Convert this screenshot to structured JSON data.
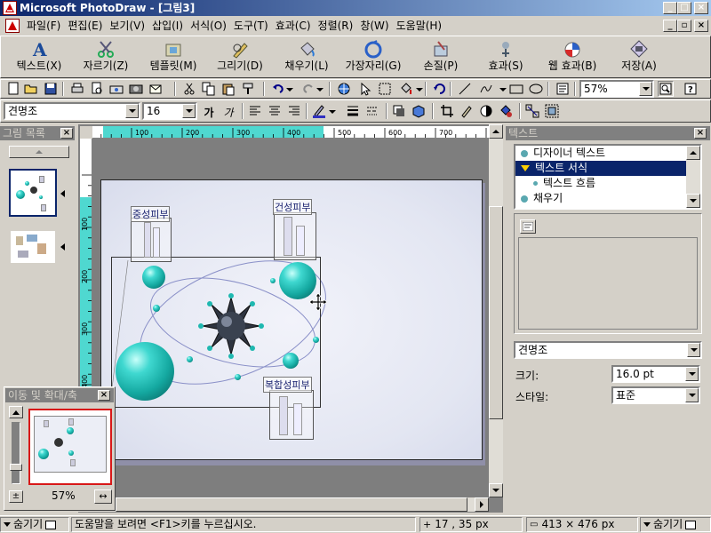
{
  "window": {
    "title": "Microsoft PhotoDraw - [그림3]",
    "controls": [
      "_",
      "□",
      "×"
    ]
  },
  "menu": {
    "items": [
      "파일(F)",
      "편집(E)",
      "보기(V)",
      "삽입(I)",
      "서식(O)",
      "도구(T)",
      "효과(C)",
      "정렬(R)",
      "창(W)",
      "도움말(H)"
    ],
    "doc_controls": [
      "_",
      "▫",
      "×"
    ]
  },
  "visual_menu": {
    "items": [
      {
        "label": "텍스트(X)",
        "icon": "text-a-icon"
      },
      {
        "label": "자르기(Z)",
        "icon": "scissors-icon"
      },
      {
        "label": "템플릿(M)",
        "icon": "template-folder-icon"
      },
      {
        "label": "그리기(D)",
        "icon": "draw-pen-icon"
      },
      {
        "label": "채우기(L)",
        "icon": "fill-bucket-icon"
      },
      {
        "label": "가장자리(G)",
        "icon": "edge-icon"
      },
      {
        "label": "손질(P)",
        "icon": "touchup-icon"
      },
      {
        "label": "효과(S)",
        "icon": "effects-icon"
      },
      {
        "label": "웹 효과(B)",
        "icon": "web-effects-icon"
      },
      {
        "label": "저장(A)",
        "icon": "save-diamond-icon"
      }
    ]
  },
  "standard_toolbar": {
    "zoom": "57%"
  },
  "format_toolbar": {
    "font": "견명조",
    "size": "16",
    "bold": "가",
    "italic": "가"
  },
  "ruler": {
    "h_labels": [
      "100",
      "200",
      "300",
      "400",
      "500",
      "600",
      "700"
    ],
    "v_labels": [
      "100",
      "200",
      "300",
      "400"
    ]
  },
  "picture_list": {
    "title": "그림 목록"
  },
  "pan_zoom": {
    "title": "이동 및 확대/축",
    "zoom": "57%"
  },
  "canvas": {
    "labels": [
      "중성피부",
      "건성피부",
      "복합성피부"
    ]
  },
  "text_panel": {
    "title": "텍스트",
    "tree": [
      {
        "label": "디자이너 텍스트",
        "level": 0,
        "selected": false
      },
      {
        "label": "텍스트 서식",
        "level": 0,
        "selected": true
      },
      {
        "label": "텍스트 흐름",
        "level": 1,
        "selected": false
      },
      {
        "label": "채우기",
        "level": 0,
        "selected": false
      }
    ],
    "font": "견명조",
    "size_label": "크기:",
    "size_value": "16.0 pt",
    "style_label": "스타일:",
    "style_value": "표준"
  },
  "status": {
    "hide_left": "숨기기",
    "help": "도움말을 보려면 <F1>키를 누르십시오.",
    "coords": "17 , 35  px",
    "dims": "413 × 476  px",
    "hide_right": "숨기기"
  },
  "colors": {
    "title_start": "#0a246a",
    "title_end": "#a6caf0",
    "selection": "#0a246a",
    "sphere": "#1fb8b0",
    "ruler_highlight": "#4fd8d0"
  }
}
